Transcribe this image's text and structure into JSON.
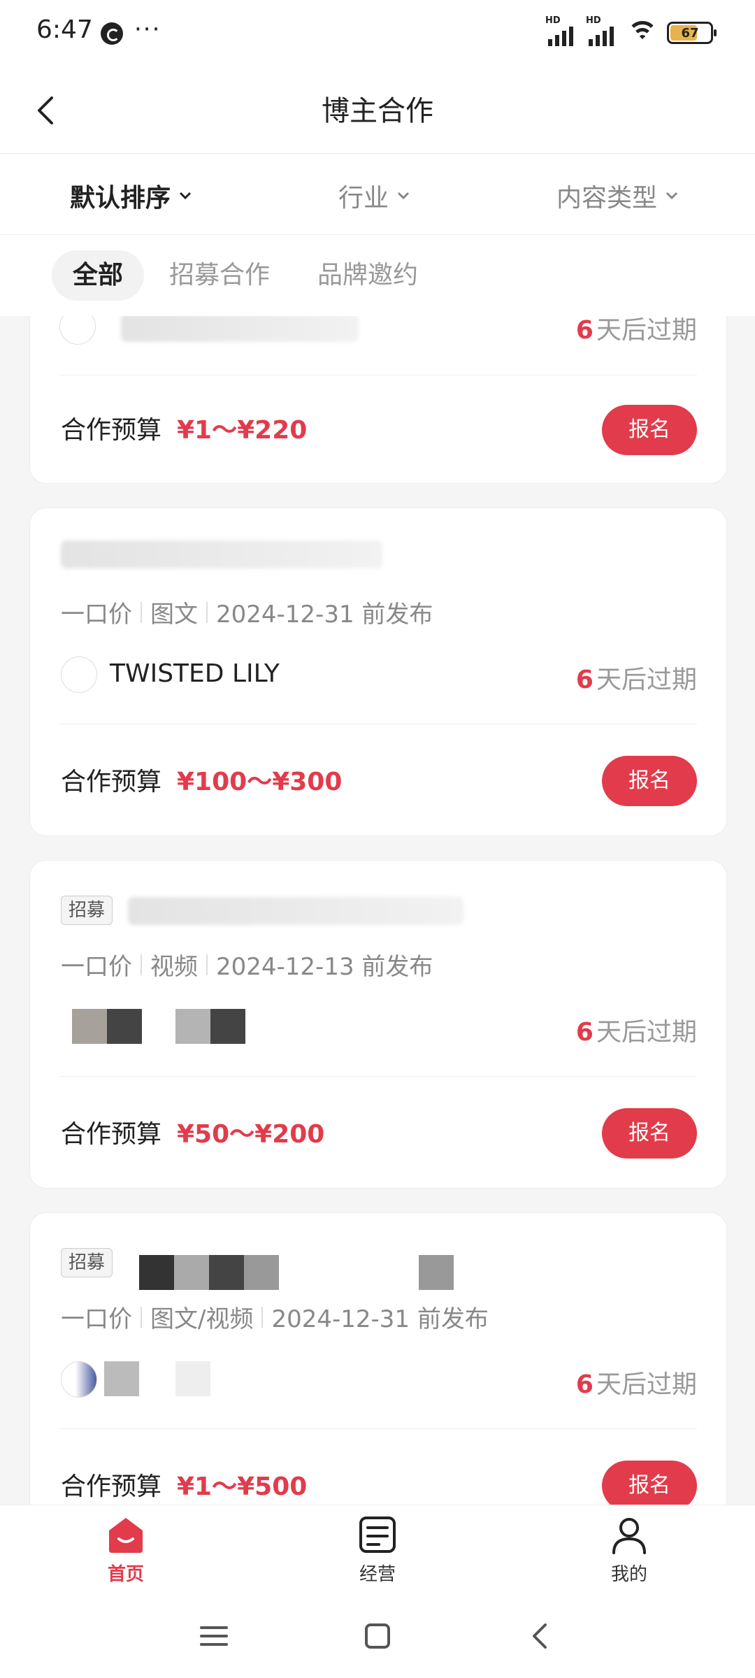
{
  "status": {
    "time": "6:47",
    "dots": "···",
    "battery": "67"
  },
  "header": {
    "title": "博主合作"
  },
  "filters": [
    {
      "label": "默认排序",
      "active": true
    },
    {
      "label": "行业",
      "active": false
    },
    {
      "label": "内容类型",
      "active": false
    }
  ],
  "tabs": [
    {
      "label": "全部",
      "active": true
    },
    {
      "label": "招募合作",
      "active": false
    },
    {
      "label": "品牌邀约",
      "active": false
    }
  ],
  "cards": [
    {
      "expiry_num": "6",
      "expiry_text": "天后过期",
      "budget_label": "合作预算",
      "budget": "¥1～¥220",
      "button": "报名"
    },
    {
      "meta": [
        "一口价",
        "图文",
        "2024-12-31 前发布"
      ],
      "brand": "TWISTED LILY",
      "expiry_num": "6",
      "expiry_text": "天后过期",
      "budget_label": "合作预算",
      "budget": "¥100～¥300",
      "button": "报名"
    },
    {
      "tag": "招募",
      "meta": [
        "一口价",
        "视频",
        "2024-12-13 前发布"
      ],
      "expiry_num": "6",
      "expiry_text": "天后过期",
      "budget_label": "合作预算",
      "budget": "¥50～¥200",
      "button": "报名"
    },
    {
      "tag": "招募",
      "meta": [
        "一口价",
        "图文/视频",
        "2024-12-31 前发布"
      ],
      "expiry_num": "6",
      "expiry_text": "天后过期",
      "budget_label": "合作预算",
      "budget": "¥1～¥500",
      "button": "报名"
    }
  ],
  "bottom_nav": [
    {
      "label": "首页",
      "icon": "home-icon",
      "active": true
    },
    {
      "label": "经营",
      "icon": "manage-icon",
      "active": false
    },
    {
      "label": "我的",
      "icon": "profile-icon",
      "active": false
    }
  ],
  "colors": {
    "accent": "#e23b4b"
  }
}
